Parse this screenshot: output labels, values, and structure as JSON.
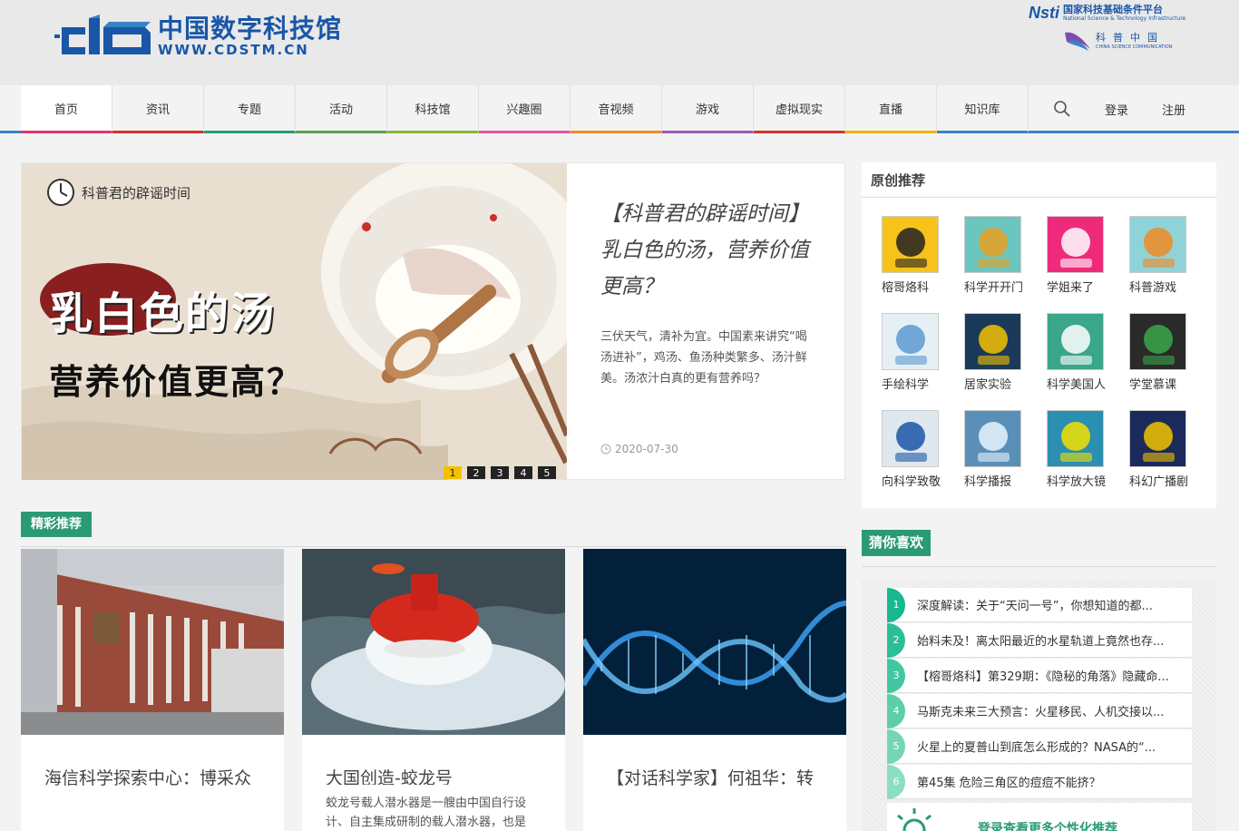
{
  "header": {
    "logo_cn": "中国数字科技馆",
    "logo_url": "WWW.CDSTM.CN",
    "partner1_mark": "Nsti",
    "partner1_cn": "国家科技基础条件平台",
    "partner1_en": "National Science & Technology Infrastructure",
    "partner2_cn": "科普中国",
    "partner2_en": "CHINA SCIENCE COMMUNICATION"
  },
  "nav": {
    "items": [
      {
        "label": "首页",
        "color": "#e8336d"
      },
      {
        "label": "资讯",
        "color": "#d1332b"
      },
      {
        "label": "专题",
        "color": "#2a9a74"
      },
      {
        "label": "活动",
        "color": "#5aa34a"
      },
      {
        "label": "科技馆",
        "color": "#88b63a"
      },
      {
        "label": "兴趣圈",
        "color": "#e8559a"
      },
      {
        "label": "音视频",
        "color": "#f08a24"
      },
      {
        "label": "游戏",
        "color": "#9a5ab0"
      },
      {
        "label": "虚拟现实",
        "color": "#d1332b"
      },
      {
        "label": "直播",
        "color": "#f2b200"
      },
      {
        "label": "知识库",
        "color": "#3a82c8"
      }
    ],
    "login": "登录",
    "register": "注册"
  },
  "featured": {
    "badge": "科普君的辟谣时间",
    "img_line1": "乳白色的汤",
    "img_line2": "营养价值更高？",
    "title": "【科普君的辟谣时间】乳白色的汤，营养价值更高？",
    "desc": "三伏天气，清补为宜。中国素来讲究“喝汤进补”，鸡汤、鱼汤种类繁多、汤汁鲜美。汤浓汁白真的更有营养吗？",
    "date": "2020-07-30",
    "pages": [
      "1",
      "2",
      "3",
      "4",
      "5"
    ]
  },
  "recommend": {
    "header": "精彩推荐",
    "cards": [
      {
        "title": "海信科学探索中心：博采众长 创新服务",
        "desc": ""
      },
      {
        "title": "大国创造-蛟龙号",
        "desc": "蛟龙号载人潜水器是一艘由中国自行设计、自主集成研制的载人潜水器，也是"
      },
      {
        "title": "【对话科学家】何祖华：转基因只是一项技术 无关食品安...",
        "desc": ""
      }
    ]
  },
  "original": {
    "header": "原创推荐",
    "items": [
      "榕哥烙科",
      "科学开开门",
      "学姐来了",
      "科普游戏",
      "手绘科学",
      "居家实验",
      "科学美国人",
      "学堂慕课",
      "向科学致敬",
      "科学播报",
      "科学放大镜",
      "科幻广播剧"
    ]
  },
  "guess": {
    "header": "猜你喜欢",
    "items": [
      {
        "num": "1",
        "text": "深度解读：关于“天问一号”，你想知道的都..."
      },
      {
        "num": "2",
        "text": "始料未及！离太阳最近的水星轨道上竟然也存..."
      },
      {
        "num": "3",
        "text": "【榕哥烙科】第329期：《隐秘的角落》隐藏命..."
      },
      {
        "num": "4",
        "text": "马斯克未来三大预言：火星移民、人机交接以..."
      },
      {
        "num": "5",
        "text": "火星上的夏普山到底怎么形成的？NASA的“..."
      },
      {
        "num": "6",
        "text": "第45集 危险三角区的痘痘不能挤？"
      }
    ],
    "more": "登录查看更多个性化推荐",
    "accent": "#2a9a74"
  }
}
